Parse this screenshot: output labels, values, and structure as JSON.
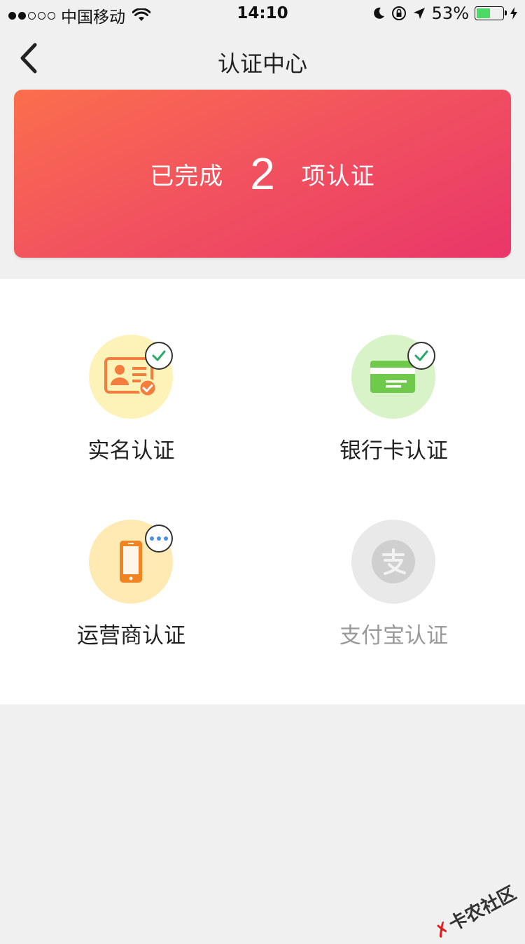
{
  "status_bar": {
    "carrier": "中国移动",
    "time": "14:10",
    "battery": "53%"
  },
  "nav": {
    "title": "认证中心"
  },
  "banner": {
    "prefix": "已完成",
    "count": "2",
    "suffix": "项认证"
  },
  "items": [
    {
      "label": "实名认证",
      "status": "done",
      "icon": "id-card-icon"
    },
    {
      "label": "银行卡认证",
      "status": "done",
      "icon": "bank-card-icon"
    },
    {
      "label": "运营商认证",
      "status": "pending",
      "icon": "phone-icon"
    },
    {
      "label": "支付宝认证",
      "status": "inactive",
      "icon": "alipay-icon"
    }
  ],
  "watermark": "卡农社区",
  "colors": {
    "banner_start": "#fb6e4c",
    "banner_end": "#e9366a",
    "check": "#2aa86a"
  }
}
